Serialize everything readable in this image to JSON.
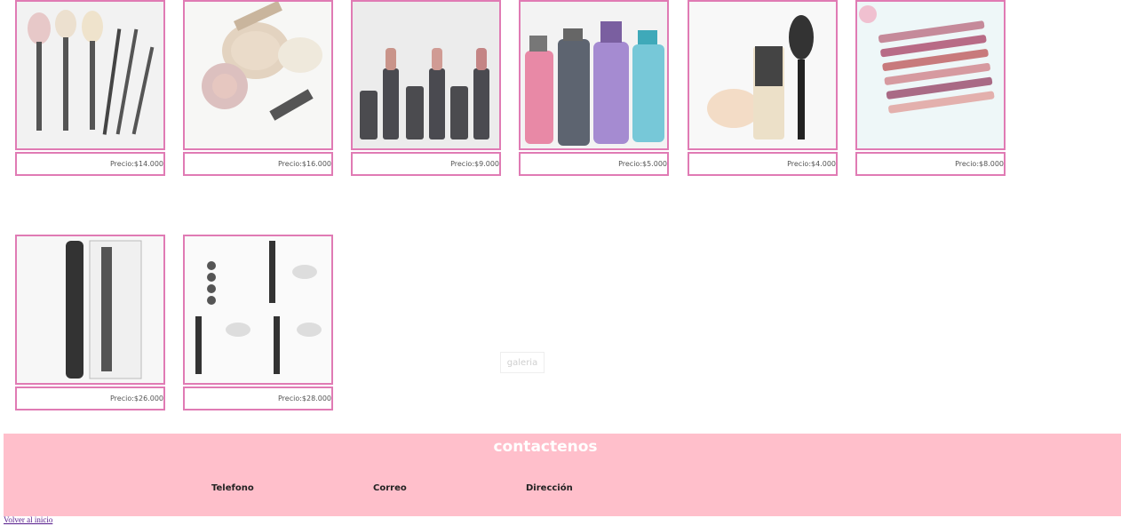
{
  "products": [
    {
      "image": "makeup-brushes-image",
      "price": "Precio:$14.000"
    },
    {
      "image": "face-powder-set-image",
      "price": "Precio:$16.000"
    },
    {
      "image": "lipsticks-image",
      "price": "Precio:$9.000"
    },
    {
      "image": "perfume-bottles-image",
      "price": "Precio:$5.000"
    },
    {
      "image": "foundation-brush-image",
      "price": "Precio:$4.000"
    },
    {
      "image": "lip-gloss-set-image",
      "price": "Precio:$8.000"
    },
    {
      "image": "nyx-mascara-image",
      "price": "Precio:$26.000"
    },
    {
      "image": "mascara-guide-image",
      "price": "Precio:$28.000"
    }
  ],
  "gallery_button": "galeria",
  "footer": {
    "title": "contactenos",
    "phone": "Telefono",
    "email": "Correo",
    "address": "Dirección"
  },
  "back_link": "Volver al inicio",
  "colors": {
    "border": "#e07bb4",
    "footer_bg": "#ffbfcb"
  }
}
